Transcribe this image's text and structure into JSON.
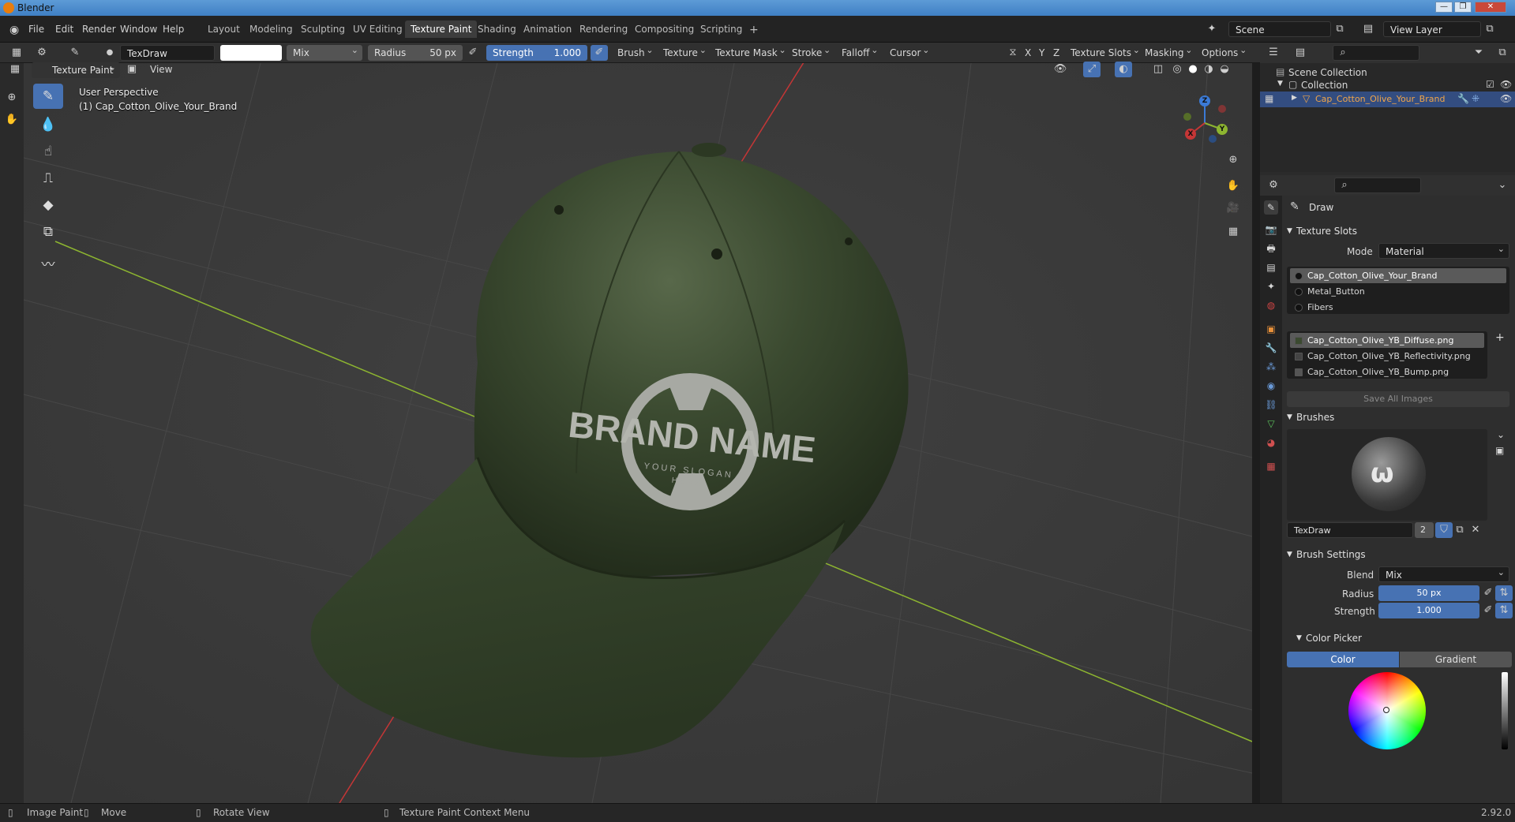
{
  "window": {
    "title": "Blender"
  },
  "menu": [
    "File",
    "Edit",
    "Render",
    "Window",
    "Help"
  ],
  "workspaces": [
    "Layout",
    "Modeling",
    "Sculpting",
    "UV Editing",
    "Texture Paint",
    "Shading",
    "Animation",
    "Rendering",
    "Compositing",
    "Scripting"
  ],
  "active_workspace": "Texture Paint",
  "scene": {
    "name": "Scene",
    "view_layer": "View Layer"
  },
  "tool_header": {
    "brush_name": "TexDraw",
    "blend": "Mix",
    "radius_label": "Radius",
    "radius_value": "50 px",
    "strength_label": "Strength",
    "strength_value": "1.000",
    "menus": [
      "Brush",
      "Texture",
      "Texture Mask",
      "Stroke",
      "Falloff",
      "Cursor"
    ],
    "axes": [
      "X",
      "Y",
      "Z"
    ],
    "right_menus": [
      "Texture Slots",
      "Masking",
      "Options"
    ]
  },
  "viewport_header": {
    "mode": "Texture Paint",
    "view": "View"
  },
  "viewport": {
    "perspective": "User Perspective",
    "object_label": "(1) Cap_Cotton_Olive_Your_Brand",
    "logo_title": "BRAND NAME",
    "logo_slogan_1": "YOUR SLOGAN",
    "logo_slogan_2": "HERE"
  },
  "gizmo": {
    "x": "X",
    "y": "Y",
    "z": "Z"
  },
  "outliner": {
    "scene_collection": "Scene Collection",
    "collection": "Collection",
    "object": "Cap_Cotton_Olive_Your_Brand"
  },
  "properties": {
    "tool_name": "Draw",
    "texture_slots_title": "Texture Slots",
    "mode_label": "Mode",
    "mode_value": "Material",
    "materials": [
      "Cap_Cotton_Olive_Your_Brand",
      "Metal_Button",
      "Fibers"
    ],
    "images": [
      "Cap_Cotton_Olive_YB_Diffuse.png",
      "Cap_Cotton_Olive_YB_Reflectivity.png",
      "Cap_Cotton_Olive_YB_Bump.png"
    ],
    "save_all": "Save All Images",
    "brushes_title": "Brushes",
    "brush_name": "TexDraw",
    "brush_users": "2",
    "brush_settings_title": "Brush Settings",
    "blend_label": "Blend",
    "blend_value": "Mix",
    "radius_label": "Radius",
    "radius_value": "50 px",
    "strength_label": "Strength",
    "strength_value": "1.000",
    "color_picker_title": "Color Picker",
    "color_tab": "Color",
    "gradient_tab": "Gradient"
  },
  "statusbar": {
    "left": "Image Paint",
    "move": "Move",
    "rotate": "Rotate View",
    "context": "Texture Paint Context Menu",
    "version": "2.92.0"
  },
  "colors": {
    "accent": "#4772b3",
    "cap": "#36452c",
    "grid_x": "#c53636",
    "grid_y": "#8db530",
    "object_name": "#f0a54a"
  }
}
